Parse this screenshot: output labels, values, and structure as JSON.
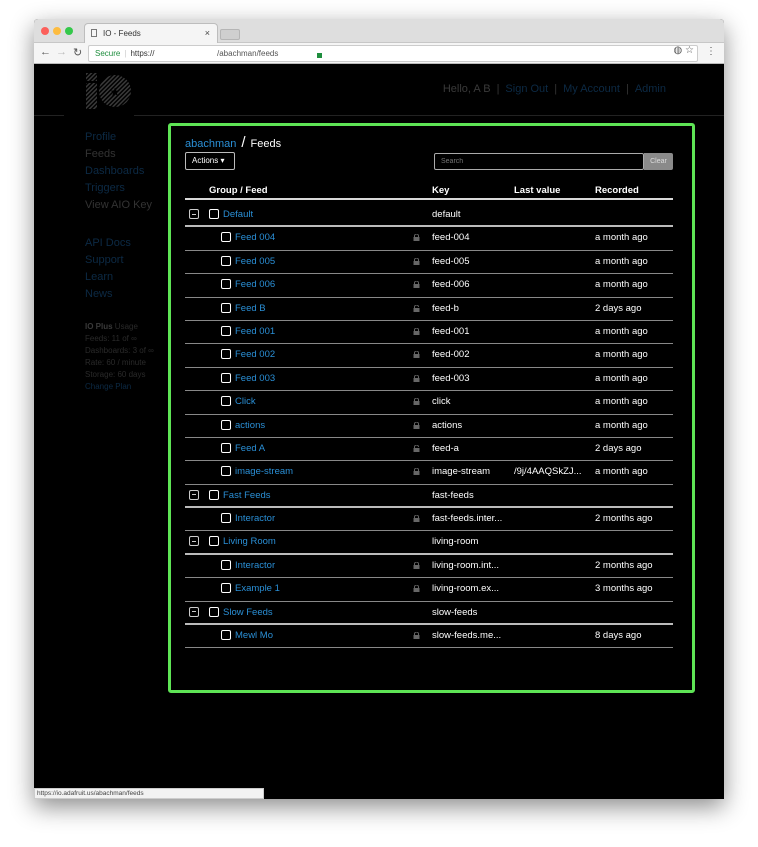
{
  "browser": {
    "tab_title": "IO - Feeds",
    "secure_label": "Secure",
    "url_scheme": "https://",
    "url_path": "/abachman/feeds",
    "status_url": "https://io.adafruit.us/abachman/feeds"
  },
  "header": {
    "greeting": "Hello, A B",
    "links": [
      "Sign Out",
      "My Account",
      "Admin"
    ]
  },
  "sidebar": {
    "items": [
      {
        "label": "Profile",
        "active": false
      },
      {
        "label": "Feeds",
        "active": true
      },
      {
        "label": "Dashboards",
        "active": false
      },
      {
        "label": "Triggers",
        "active": false
      },
      {
        "label": "View AIO Key",
        "active": false
      }
    ],
    "secondary": [
      "API Docs",
      "Support",
      "Learn",
      "News"
    ],
    "usage": {
      "plan": "IO Plus",
      "title_suffix": "Usage",
      "lines": [
        "Feeds: 11 of ∞",
        "Dashboards: 3 of ∞",
        "Rate: 60 / minute",
        "Storage: 60 days"
      ],
      "change_plan": "Change Plan"
    }
  },
  "main": {
    "breadcrumb": {
      "user": "abachman",
      "separator": "/",
      "page": "Feeds"
    },
    "actions_label": "Actions ▾",
    "search_placeholder": "Search",
    "clear_label": "Clear",
    "columns": [
      "Group / Feed",
      "Key",
      "Last value",
      "Recorded"
    ],
    "rows": [
      {
        "type": "group",
        "name": "Default",
        "key": "default",
        "last": "",
        "recorded": ""
      },
      {
        "type": "feed",
        "name": "Feed 004",
        "key": "feed-004",
        "last": "",
        "recorded": "a month ago",
        "locked": true
      },
      {
        "type": "feed",
        "name": "Feed 005",
        "key": "feed-005",
        "last": "",
        "recorded": "a month ago",
        "locked": true
      },
      {
        "type": "feed",
        "name": "Feed 006",
        "key": "feed-006",
        "last": "",
        "recorded": "a month ago",
        "locked": true
      },
      {
        "type": "feed",
        "name": "Feed B",
        "key": "feed-b",
        "last": "",
        "recorded": "2 days ago",
        "locked": false
      },
      {
        "type": "feed",
        "name": "Feed 001",
        "key": "feed-001",
        "last": "",
        "recorded": "a month ago",
        "locked": true
      },
      {
        "type": "feed",
        "name": "Feed 002",
        "key": "feed-002",
        "last": "",
        "recorded": "a month ago",
        "locked": true
      },
      {
        "type": "feed",
        "name": "Feed 003",
        "key": "feed-003",
        "last": "",
        "recorded": "a month ago",
        "locked": true
      },
      {
        "type": "feed",
        "name": "Click",
        "key": "click",
        "last": "",
        "recorded": "a month ago",
        "locked": true
      },
      {
        "type": "feed",
        "name": "actions",
        "key": "actions",
        "last": "",
        "recorded": "a month ago",
        "locked": true
      },
      {
        "type": "feed",
        "name": "Feed A",
        "key": "feed-a",
        "last": "",
        "recorded": "2 days ago",
        "locked": false
      },
      {
        "type": "feed",
        "name": "image-stream",
        "key": "image-stream",
        "last": "/9j/4AAQSkZJ...",
        "recorded": "a month ago",
        "locked": true
      },
      {
        "type": "group",
        "name": "Fast Feeds",
        "key": "fast-feeds",
        "last": "",
        "recorded": ""
      },
      {
        "type": "feed",
        "name": "Interactor",
        "key": "fast-feeds.inter...",
        "last": "",
        "recorded": "2 months ago",
        "locked": true
      },
      {
        "type": "group",
        "name": "Living Room",
        "key": "living-room",
        "last": "",
        "recorded": ""
      },
      {
        "type": "feed",
        "name": "Interactor",
        "key": "living-room.int...",
        "last": "",
        "recorded": "2 months ago",
        "locked": true
      },
      {
        "type": "feed",
        "name": "Example 1",
        "key": "living-room.ex...",
        "last": "",
        "recorded": "3 months ago",
        "locked": true
      },
      {
        "type": "group",
        "name": "Slow Feeds",
        "key": "slow-feeds",
        "last": "",
        "recorded": ""
      },
      {
        "type": "feed",
        "name": "Mewl Mo",
        "key": "slow-feeds.me...",
        "last": "",
        "recorded": "8 days ago",
        "locked": true
      }
    ]
  },
  "colors": {
    "accent": "#2a8fd6",
    "highlight": "#5ee455",
    "background": "#000000"
  }
}
